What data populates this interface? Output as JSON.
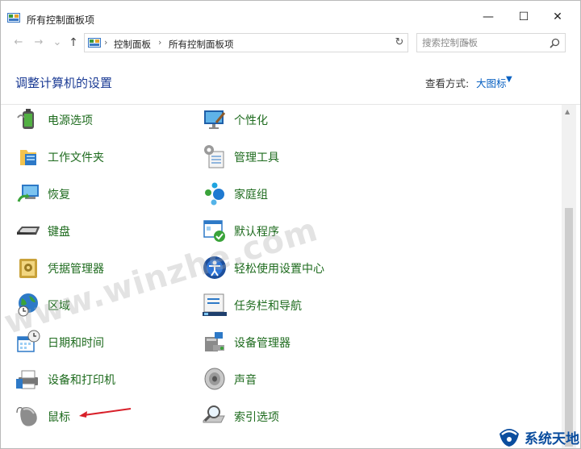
{
  "window": {
    "title": "所有控制面板项",
    "minimize": "—",
    "maximize": "☐",
    "close": "✕"
  },
  "nav": {
    "back": "←",
    "forward": "→",
    "recent": "⌄",
    "up": "↑",
    "breadcrumbs": [
      "控制面板",
      "所有控制面板项"
    ],
    "separator": "›",
    "dropdown": "⌄",
    "refresh": "↻",
    "search_placeholder": "搜索控制面板"
  },
  "header": {
    "title": "调整计算机的设置",
    "view_by_label": "查看方式:",
    "view_by_value": "大图标",
    "view_caret": "▼"
  },
  "items": [
    {
      "label": "电源选项",
      "icon": "power-options-icon"
    },
    {
      "label": "个性化",
      "icon": "personalization-icon"
    },
    {
      "label": "工作文件夹",
      "icon": "work-folders-icon"
    },
    {
      "label": "管理工具",
      "icon": "admin-tools-icon"
    },
    {
      "label": "恢复",
      "icon": "recovery-icon"
    },
    {
      "label": "家庭组",
      "icon": "homegroup-icon"
    },
    {
      "label": "键盘",
      "icon": "keyboard-icon"
    },
    {
      "label": "默认程序",
      "icon": "default-programs-icon"
    },
    {
      "label": "凭据管理器",
      "icon": "credential-manager-icon"
    },
    {
      "label": "轻松使用设置中心",
      "icon": "ease-of-access-icon"
    },
    {
      "label": "区域",
      "icon": "region-icon"
    },
    {
      "label": "任务栏和导航",
      "icon": "taskbar-navigation-icon"
    },
    {
      "label": "日期和时间",
      "icon": "date-time-icon"
    },
    {
      "label": "设备管理器",
      "icon": "device-manager-icon"
    },
    {
      "label": "设备和打印机",
      "icon": "devices-printers-icon"
    },
    {
      "label": "声音",
      "icon": "sound-icon"
    },
    {
      "label": "鼠标",
      "icon": "mouse-icon"
    },
    {
      "label": "索引选项",
      "icon": "indexing-options-icon"
    }
  ],
  "overlay": {
    "watermark": "www.winzhe.com",
    "brand": "系统天地"
  },
  "colors": {
    "heading": "#1a3a94",
    "item_label": "#1e6b1e",
    "link": "#0b62c2",
    "arrow": "#d8202a"
  }
}
